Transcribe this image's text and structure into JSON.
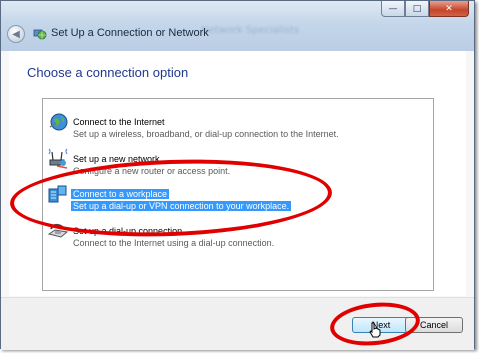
{
  "window": {
    "title": "Set Up a Connection or Network",
    "blurred_title": "Network Specialists",
    "controls": {
      "minimize": "—",
      "maximize": "□",
      "close": "✕"
    }
  },
  "heading": "Choose a connection option",
  "options": [
    {
      "title": "Connect to the Internet",
      "desc": "Set up a wireless, broadband, or dial-up connection to the Internet.",
      "icon": "globe-icon",
      "selected": false
    },
    {
      "title": "Set up a new network",
      "desc": "Configure a new router or access point.",
      "icon": "network-router-icon",
      "selected": false
    },
    {
      "title": "Connect to a workplace",
      "desc": "Set up a dial-up or VPN connection to your workplace.",
      "icon": "workplace-vpn-icon",
      "selected": true
    },
    {
      "title": "Set up a dial-up connection",
      "desc": "Connect to the Internet using a dial-up connection.",
      "icon": "telephone-modem-icon",
      "selected": false
    }
  ],
  "buttons": {
    "next": "Next",
    "cancel": "Cancel"
  },
  "colors": {
    "highlight_oval": "#e00000",
    "selection": "#3399ff",
    "heading": "#1e3a8c"
  }
}
